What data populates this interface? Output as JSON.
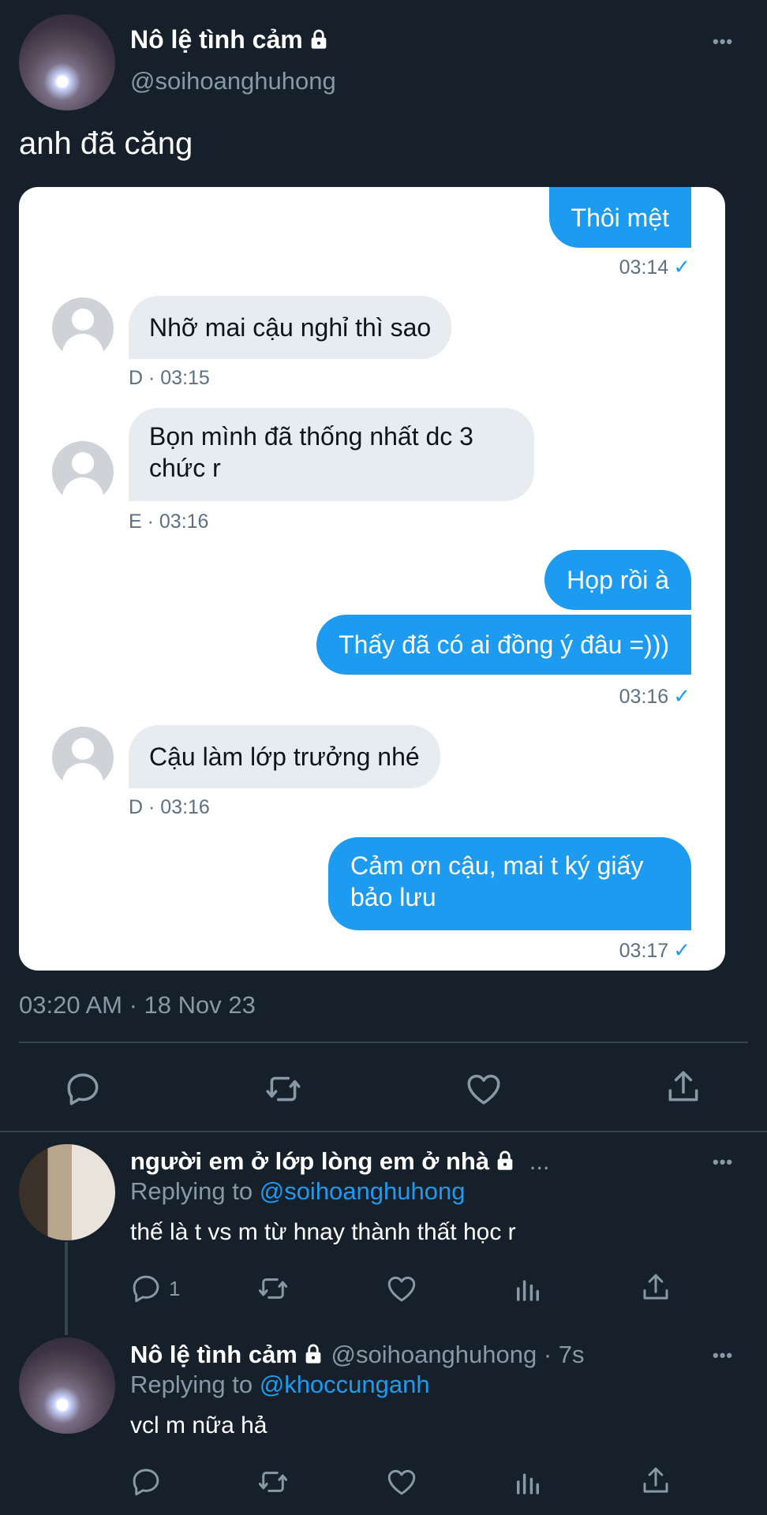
{
  "tweet": {
    "author_name": "Nô lệ tình cảm",
    "author_handle": "@soihoanghuhong",
    "more": "•••",
    "text": "anh đã căng",
    "timestamp": "03:20 AM · 18 Nov 23"
  },
  "chat": {
    "messages": [
      {
        "side": "out",
        "text": "Thôi mệt"
      },
      {
        "side": "out_meta",
        "time": "03:14",
        "check": "✓"
      },
      {
        "side": "in",
        "text": "Nhỡ mai cậu nghỉ thì sao",
        "meta": "D · 03:15"
      },
      {
        "side": "in",
        "text": "Bọn mình đã thống nhất dc 3 chức r",
        "meta": "E · 03:16"
      },
      {
        "side": "out",
        "text": "Họp rồi à"
      },
      {
        "side": "out",
        "text": "Thấy đã có ai đồng ý đâu =)))"
      },
      {
        "side": "out_meta",
        "time": "03:16",
        "check": "✓"
      },
      {
        "side": "in",
        "text": "Cậu làm lớp trưởng nhé",
        "meta": "D · 03:16"
      },
      {
        "side": "out",
        "text": "Cảm ơn cậu, mai t ký giấy bảo lưu"
      },
      {
        "side": "out_meta",
        "time": "03:17",
        "check": "✓"
      }
    ]
  },
  "replies": [
    {
      "author_name": "người em ở lớp lòng em ở nhà",
      "ellipsis": "...",
      "replying_prefix": "Replying to",
      "replying_to": "@soihoanghuhong",
      "text": "thế là t vs m từ hnay thành thất học r",
      "reply_count": "1",
      "more": "•••"
    },
    {
      "author_name": "Nô lệ tình cảm",
      "author_handle": "@soihoanghuhong",
      "time_ago": "· 7s",
      "replying_prefix": "Replying to",
      "replying_to": "@khoccunganh",
      "text": "vcl m nữa hả",
      "more": "•••"
    }
  ],
  "icons": {
    "reply": "reply-icon",
    "retweet": "retweet-icon",
    "like": "heart-icon",
    "share": "share-icon",
    "analytics": "analytics-icon",
    "lock": "lock-icon"
  },
  "colors": {
    "background": "#15202b",
    "accent": "#1d9bf0",
    "muted": "#8899a6",
    "incoming_bubble": "#e6ecf0"
  }
}
